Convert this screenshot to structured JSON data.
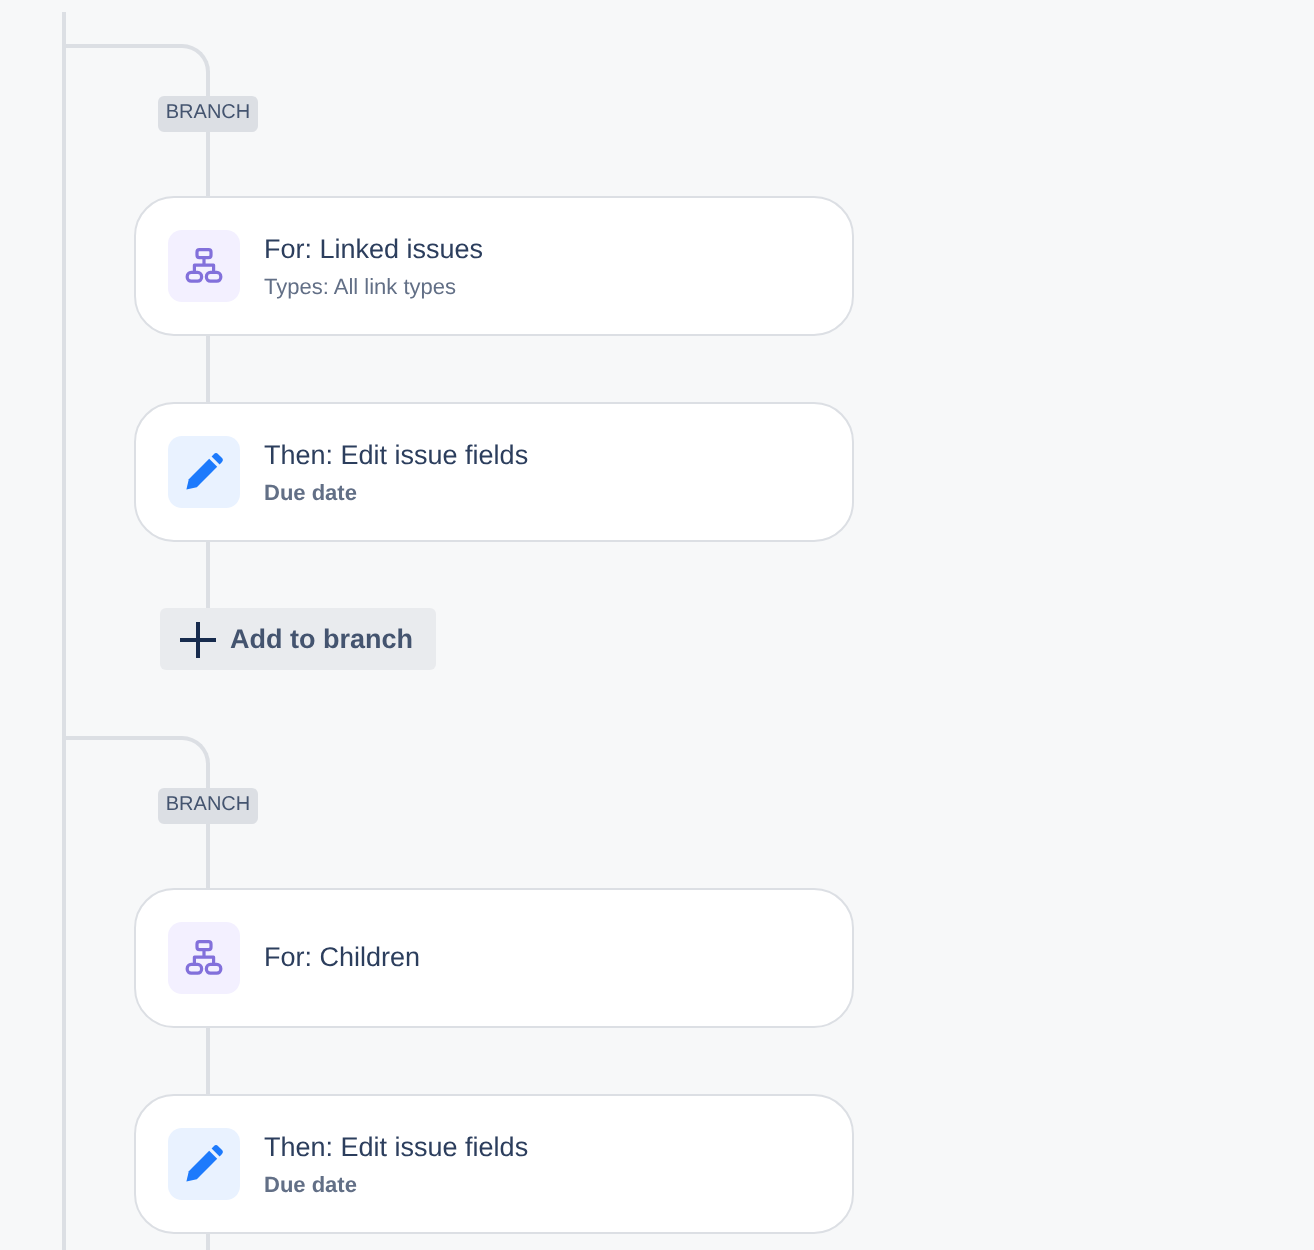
{
  "branches": [
    {
      "tag": "BRANCH",
      "steps": [
        {
          "kind": "for",
          "title": "For: Linked issues",
          "detail": "Types: All link types"
        },
        {
          "kind": "then",
          "title": "Then: Edit issue fields",
          "detail": "Due date"
        }
      ],
      "add_button": {
        "label": "Add to branch"
      }
    },
    {
      "tag": "BRANCH",
      "steps": [
        {
          "kind": "for",
          "title": "For: Children"
        },
        {
          "kind": "then",
          "title": "Then: Edit issue fields",
          "detail": "Due date"
        }
      ]
    }
  ]
}
